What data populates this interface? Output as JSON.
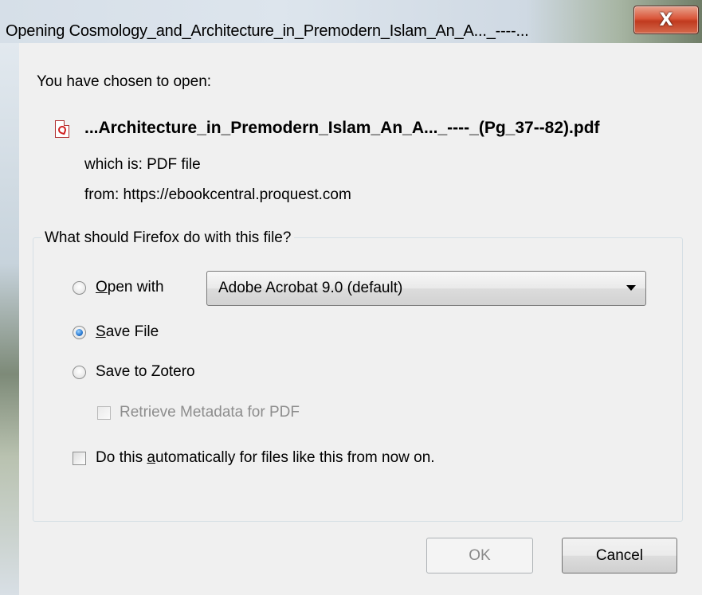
{
  "window": {
    "title": "Opening Cosmology_and_Architecture_in_Premodern_Islam_An_A..._----...",
    "close_glyph": "X"
  },
  "dialog": {
    "intro": "You have chosen to open:",
    "file_name": "...Architecture_in_Premodern_Islam_An_A..._----_(Pg_37--82).pdf",
    "which_is": "which is: PDF file",
    "from": "from: https://ebookcentral.proquest.com",
    "file_icon": "pdf-file-icon",
    "group_label": "What should Firefox do with this file?",
    "open_with": {
      "label_accel": "O",
      "label_rest": "pen with",
      "selected": false,
      "app_value": "Adobe Acrobat 9.0 (default)"
    },
    "save_file": {
      "label_accel": "S",
      "label_rest": "ave File",
      "selected": true
    },
    "save_to_zotero": {
      "label": "Save to Zotero",
      "selected": false
    },
    "retrieve_metadata": {
      "label": "Retrieve Metadata for PDF",
      "checked": false,
      "disabled": true
    },
    "auto": {
      "label_pre": "Do this ",
      "label_accel": "a",
      "label_post": "utomatically for files like this from now on.",
      "checked": false
    },
    "buttons": {
      "ok": "OK",
      "ok_disabled": true,
      "cancel": "Cancel"
    }
  }
}
